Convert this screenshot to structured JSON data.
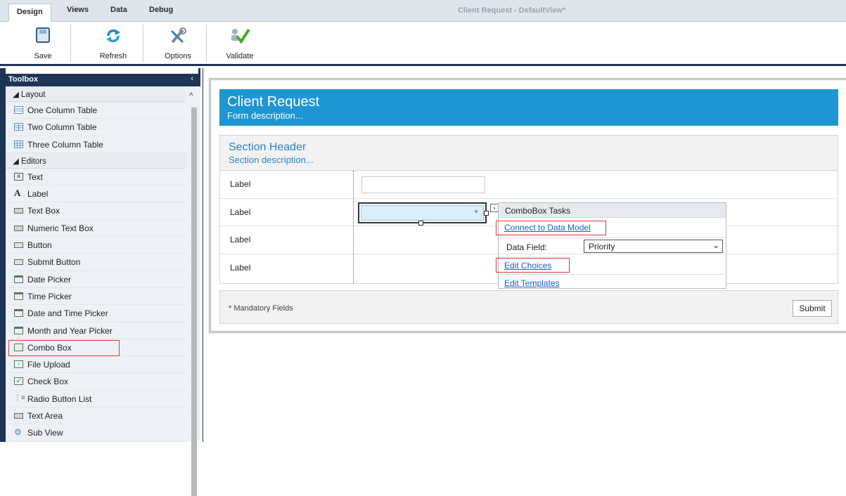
{
  "ribbon_tabs": [
    "Design",
    "Views",
    "Data",
    "Debug"
  ],
  "document_title": "Client Request - DefaultView*",
  "ribbon_buttons": {
    "save": "Save",
    "refresh": "Refresh",
    "options": "Options",
    "validate": "Validate"
  },
  "toolbox": {
    "title": "Toolbox",
    "collapse": "‹",
    "scroll_up": "^",
    "groups": {
      "layout": "Layout",
      "editors": "Editors"
    },
    "layout_items": [
      "One Column Table",
      "Two Column Table",
      "Three Column Table"
    ],
    "editor_items": [
      "Text",
      "Label",
      "Text Box",
      "Numeric Text Box",
      "Button",
      "Submit Button",
      "Date Picker",
      "Time Picker",
      "Date and Time Picker",
      "Month and Year Picker",
      "Combo Box",
      "File Upload",
      "Check Box",
      "Radio Button List",
      "Text Area",
      "Sub View"
    ]
  },
  "form": {
    "title": "Client Request",
    "description": "Form description...",
    "section_title": "Section Header",
    "section_description": "Section description...",
    "row_labels": [
      "Label",
      "Label",
      "Label",
      "Label"
    ],
    "mandatory_note": "* Mandatory Fields",
    "submit_label": "Submit"
  },
  "combobox_tasks": {
    "title": "ComboBox Tasks",
    "connect": "Connect to Data Model",
    "data_field_label": "Data Field:",
    "data_field_value": "Priority",
    "edit_choices": "Edit Choices",
    "edit_templates": "Edit Templates"
  },
  "colors": {
    "navy": "#1e3556",
    "header_blue": "#1e96d3",
    "highlight_red": "#e33",
    "link_blue": "#1a5ec4"
  }
}
